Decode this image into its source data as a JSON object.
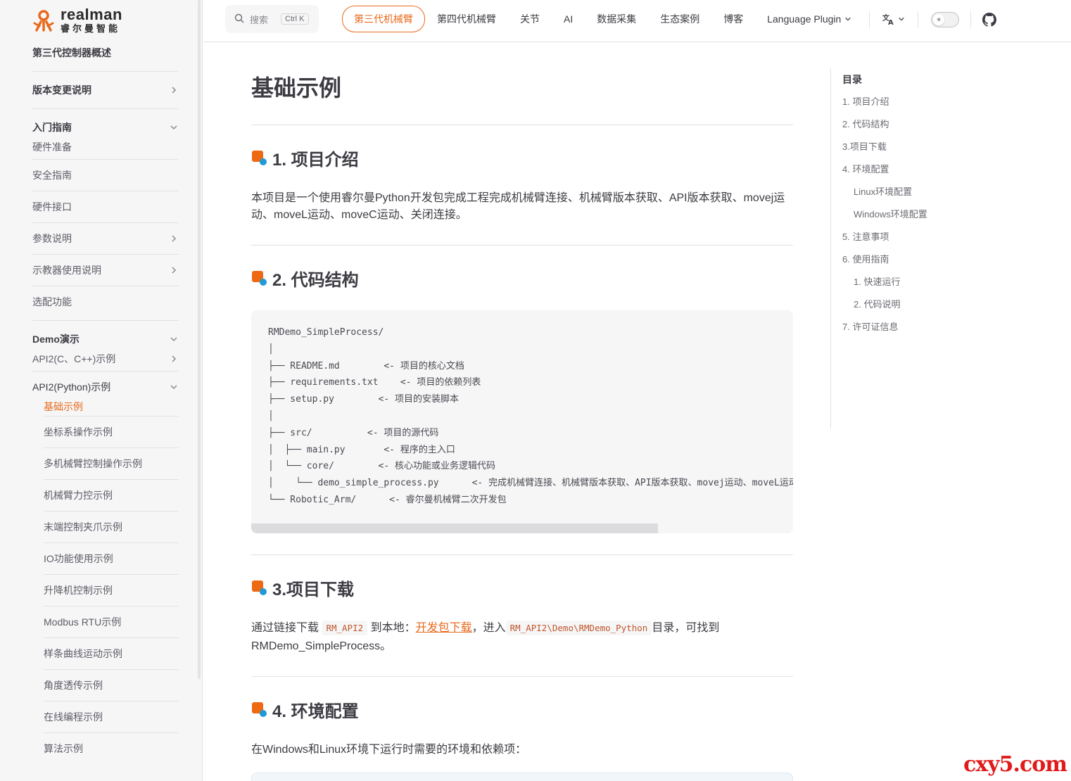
{
  "brand": {
    "name_en": "realman",
    "name_cn": "睿尔曼智能",
    "color": "#e8691c"
  },
  "search": {
    "placeholder": "搜索",
    "shortcut": "Ctrl K"
  },
  "topnav": {
    "items": [
      "第三代机械臂",
      "第四代机械臂",
      "关节",
      "AI",
      "数据采集",
      "生态案例",
      "博客",
      "Language Plugin"
    ],
    "active": "第三代机械臂"
  },
  "sidebar": {
    "overview": "第三代控制器概述",
    "changelog": "版本变更说明",
    "getting_started": "入门指南",
    "gs_items": [
      "硬件准备",
      "安全指南",
      "硬件接口",
      "参数说明",
      "示教器使用说明",
      "选配功能"
    ],
    "demo": "Demo演示",
    "api2_c": "API2(C、C++)示例",
    "api2_python": "API2(Python)示例",
    "python_items": [
      "基础示例",
      "坐标系操作示例",
      "多机械臂控制操作示例",
      "机械臂力控示例",
      "末端控制夹爪示例",
      "IO功能使用示例",
      "升降机控制示例",
      "Modbus RTU示例",
      "样条曲线运动示例",
      "角度透传示例",
      "在线编程示例",
      "算法示例"
    ]
  },
  "page": {
    "title": "基础示例",
    "s1_title": "1. 项目介绍",
    "s1_text": "本项目是一个使用睿尔曼Python开发包完成工程完成机械臂连接、机械臂版本获取、API版本获取、movej运动、moveL运动、moveC运动、关闭连接。",
    "s2_title": "2. 代码结构",
    "code": [
      "RMDemo_SimpleProcess/",
      "│",
      "├── README.md        <- 项目的核心文档",
      "├── requirements.txt    <- 项目的依赖列表",
      "├── setup.py        <- 项目的安装脚本",
      "│",
      "├── src/          <- 项目的源代码",
      "│  ├── main.py       <- 程序的主入口",
      "│  └── core/        <- 核心功能或业务逻辑代码",
      "│    └── demo_simple_process.py      <- 完成机械臂连接、机械臂版本获取、API版本获取、movej运动、moveL运动",
      "└── Robotic_Arm/      <- 睿尔曼机械臂二次开发包"
    ],
    "s3_title": "3.项目下载",
    "s3_pre": "通过链接下载",
    "s3_code1": "RM_API2",
    "s3_mid": "到本地：",
    "s3_link": "开发包下载",
    "s3_mid2": "，进入",
    "s3_code2": "RM_API2\\Demo\\RMDemo_Python",
    "s3_post": "目录，可找到",
    "s3_line2": "RMDemo_SimpleProcess。",
    "s4_title": "4. 环境配置",
    "s4_text": "在Windows和Linux环境下运行时需要的环境和依赖项："
  },
  "toc": {
    "title": "目录",
    "items": [
      "1. 项目介绍",
      "2. 代码结构",
      "3.项目下载",
      "4. 环境配置",
      "Linux环境配置",
      "Windows环境配置",
      "5. 注意事项",
      "6. 使用指南",
      "1. 快速运行",
      "2. 代码说明",
      "7. 许可证信息"
    ]
  },
  "watermark": "cxy5.com"
}
